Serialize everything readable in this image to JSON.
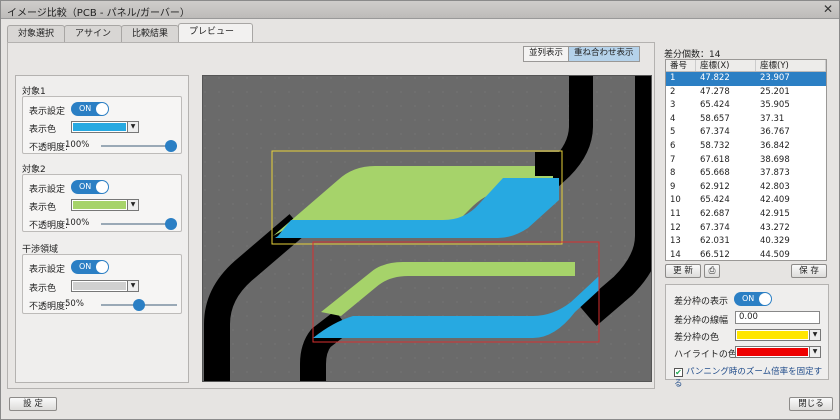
{
  "window": {
    "title": "イメージ比較（PCB - パネル/ガーバー）",
    "close_glyph": "✕"
  },
  "tabs": [
    {
      "label": "対象選択"
    },
    {
      "label": "アサイン"
    },
    {
      "label": "比較結果"
    },
    {
      "label": "プレビュー",
      "active": true
    }
  ],
  "view_buttons": {
    "side_by_side": "並列表示",
    "overlay": "重ね合わせ表示",
    "selected": "overlay"
  },
  "target1": {
    "heading": "対象1",
    "display_label": "表示設定",
    "toggle": "ON",
    "color_label": "表示色",
    "color": "#27a9e1",
    "opacity_label": "不透明度:",
    "opacity": "100%",
    "opacity_value": 1.0
  },
  "target2": {
    "heading": "対象2",
    "display_label": "表示設定",
    "toggle": "ON",
    "color_label": "表示色",
    "color": "#a6d36a",
    "opacity_label": "不透明度:",
    "opacity": "100%",
    "opacity_value": 1.0
  },
  "interference": {
    "heading": "干渉領域",
    "display_label": "表示設定",
    "toggle": "ON",
    "color_label": "表示色",
    "color": "#d0d0d0",
    "opacity_label": "不透明度:",
    "opacity": "50%",
    "opacity_value": 0.5
  },
  "canvas": {
    "bg": "#6a6a6a",
    "frame1_color": "#e8d23a",
    "frame2_color": "#d83030"
  },
  "diff": {
    "count_label": "差分個数：14",
    "columns": [
      "番号",
      "座標(X)",
      "座標(Y)"
    ],
    "rows": [
      [
        "1",
        "47.822",
        "23.907"
      ],
      [
        "2",
        "47.278",
        "25.201"
      ],
      [
        "3",
        "65.424",
        "35.905"
      ],
      [
        "4",
        "58.657",
        "37.31"
      ],
      [
        "5",
        "67.374",
        "36.767"
      ],
      [
        "6",
        "58.732",
        "36.842"
      ],
      [
        "7",
        "67.618",
        "38.698"
      ],
      [
        "8",
        "65.668",
        "37.873"
      ],
      [
        "9",
        "62.912",
        "42.803"
      ],
      [
        "10",
        "65.424",
        "42.409"
      ],
      [
        "11",
        "62.687",
        "42.915"
      ],
      [
        "12",
        "67.374",
        "43.272"
      ],
      [
        "13",
        "62.031",
        "40.329"
      ],
      [
        "14",
        "66.512",
        "44.509"
      ]
    ],
    "selected_row": 0,
    "refresh_label": "更 新",
    "print_icon": "printer-icon",
    "save_label": "保 存"
  },
  "props": {
    "show_frame_label": "差分枠の表示",
    "show_frame_toggle": "ON",
    "frame_width_label": "差分枠の線幅",
    "frame_width_value": "0.00",
    "frame_color_label": "差分枠の色",
    "frame_color": "#ffe600",
    "highlight_label": "ハイライトの色",
    "highlight_color": "#ee0000",
    "fix_zoom_label": "パンニング時のズーム倍率を固定する",
    "fix_zoom_checked": true
  },
  "footer": {
    "settings_label": "設 定",
    "close_label": "閉じる"
  }
}
